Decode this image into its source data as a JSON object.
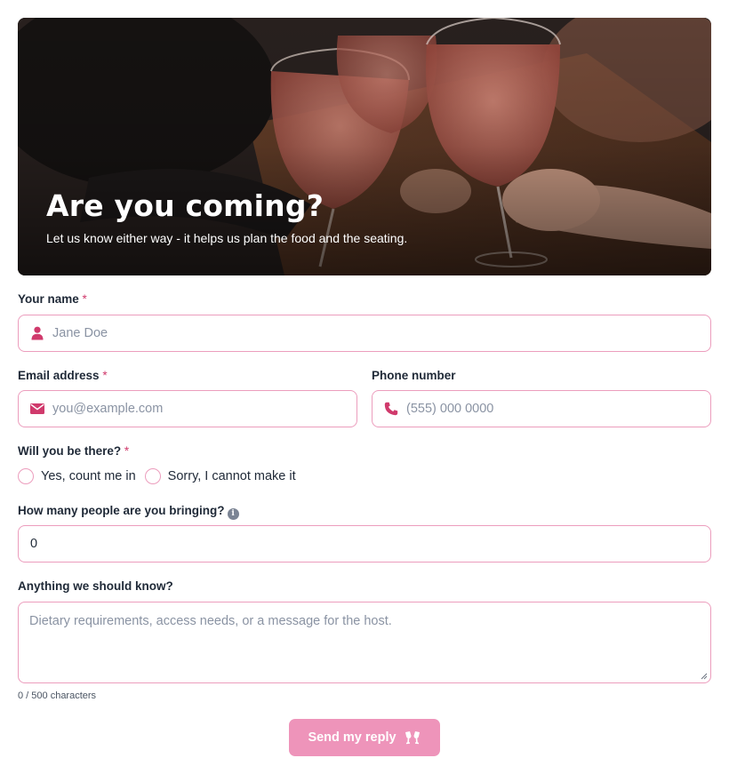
{
  "hero": {
    "title": "Are you coming?",
    "subtitle": "Let us know either way - it helps us plan the food and the seating."
  },
  "form": {
    "name": {
      "label": "Your name",
      "required_mark": "*",
      "placeholder": "Jane Doe",
      "value": "",
      "icon": "user-icon"
    },
    "email": {
      "label": "Email address",
      "required_mark": "*",
      "placeholder": "you@example.com",
      "value": "",
      "icon": "envelope-icon"
    },
    "phone": {
      "label": "Phone number",
      "placeholder": "(555) 000 0000",
      "value": "",
      "icon": "phone-icon"
    },
    "attendance": {
      "label": "Will you be there?",
      "required_mark": "*",
      "options": [
        {
          "label": "Yes, count me in",
          "selected": false
        },
        {
          "label": "Sorry, I cannot make it",
          "selected": false
        }
      ]
    },
    "guests": {
      "label": "How many people are you bringing?",
      "info_icon": "info-icon",
      "value": "0"
    },
    "notes": {
      "label": "Anything we should know?",
      "placeholder": "Dietary requirements, access needs, or a message for the host.",
      "value": "",
      "counter": "0 / 500 characters"
    },
    "submit": {
      "label": "Send my reply",
      "icon": "clinking-glasses-icon"
    }
  },
  "colors": {
    "accent": "#d03a6c",
    "field_border": "#ec9dbd",
    "submit_bg": "#ee94ba",
    "text": "#1f2937",
    "placeholder": "#8a93a3"
  }
}
